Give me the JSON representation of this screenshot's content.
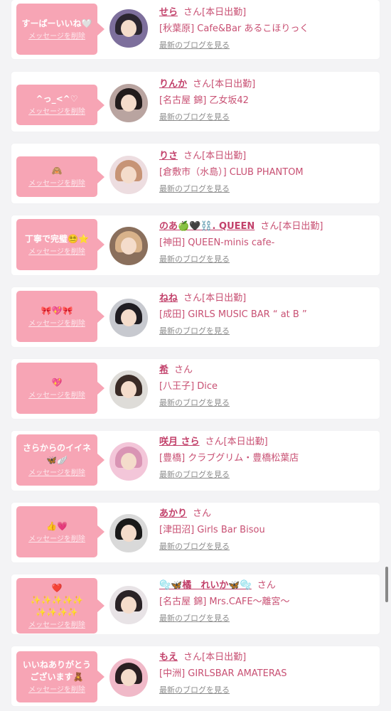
{
  "colors": {
    "accent": "#c2406a",
    "bubble": "#f7a5b5",
    "background": "#f3f3f5"
  },
  "delete_label": "メッセージを削除",
  "blog_label": "最新のブログを見る",
  "cards": [
    {
      "message": "すーぱーいいね🤍",
      "name": "せら",
      "honorific": "さん",
      "badge": "[本日出勤]",
      "shop": "[秋葉原] Cafe&Bar あるこほりっく",
      "avatar_bg": "#7d6f9c",
      "avatar_hair": "#2b2630"
    },
    {
      "message": "^っ_<^♡",
      "name": "りんか",
      "honorific": "さん",
      "badge": "[本日出勤]",
      "shop": "[名古屋 錦] 乙女坂42",
      "avatar_bg": "#b9a4a0",
      "avatar_hair": "#221c1c"
    },
    {
      "message": "🙈",
      "name": "りさ",
      "honorific": "さん",
      "badge": "[本日出勤]",
      "shop": "[倉敷市（水島）] CLUB PHANTOM",
      "avatar_bg": "#eddde0",
      "avatar_hair": "#c79476"
    },
    {
      "message": "丁寧で完璧😵‍💫⭐️",
      "name": "のあ🍏🖤⛓️. QUEEN",
      "honorific": "さん",
      "badge": "[本日出勤]",
      "shop": "[神田] QUEEN-minis cafe-",
      "avatar_bg": "#8a6f5c",
      "avatar_hair": "#d8b28a"
    },
    {
      "message": "🎀💖🎀",
      "name": "ねね",
      "honorific": "さん",
      "badge": "[本日出勤]",
      "shop": "[成田] GIRLS MUSIC BAR “ at B ”",
      "avatar_bg": "#c7c9cf",
      "avatar_hair": "#1f1d22"
    },
    {
      "message": "💖",
      "name": "希",
      "honorific": "さん",
      "badge": "",
      "shop": "[八王子] Dice",
      "avatar_bg": "#dedcd8",
      "avatar_hair": "#3a2b26"
    },
    {
      "message": "さらからのイイネ\n🦋🪽",
      "name": "咲月 さら",
      "honorific": "さん",
      "badge": "[本日出勤]",
      "shop": "[豊橋] クラブグリム・豊橋松葉店",
      "avatar_bg": "#f3c6d9",
      "avatar_hair": "#d994b4"
    },
    {
      "message": "👍💗",
      "name": "あかり",
      "honorific": "さん",
      "badge": "",
      "shop": "[津田沼] Girls Bar Bisou",
      "avatar_bg": "#d9d9d9",
      "avatar_hair": "#1a1a1a"
    },
    {
      "message": "❤️\n✨✨✨✨✨\n✨✨✨✨",
      "name": "🫧🦋橘　れいか🦋🫧",
      "honorific": "さん",
      "badge": "",
      "shop": "[名古屋 錦] Mrs.CAFE〜離宮〜",
      "avatar_bg": "#e8e3e6",
      "avatar_hair": "#2a2326"
    },
    {
      "message": "いいねありがとう\nございます🧸",
      "name": "もえ",
      "honorific": "さん",
      "badge": "[本日出勤]",
      "shop": "[中洲] GIRLSBAR AMATERAS",
      "avatar_bg": "#f0b9c8",
      "avatar_hair": "#2a1f22"
    }
  ]
}
